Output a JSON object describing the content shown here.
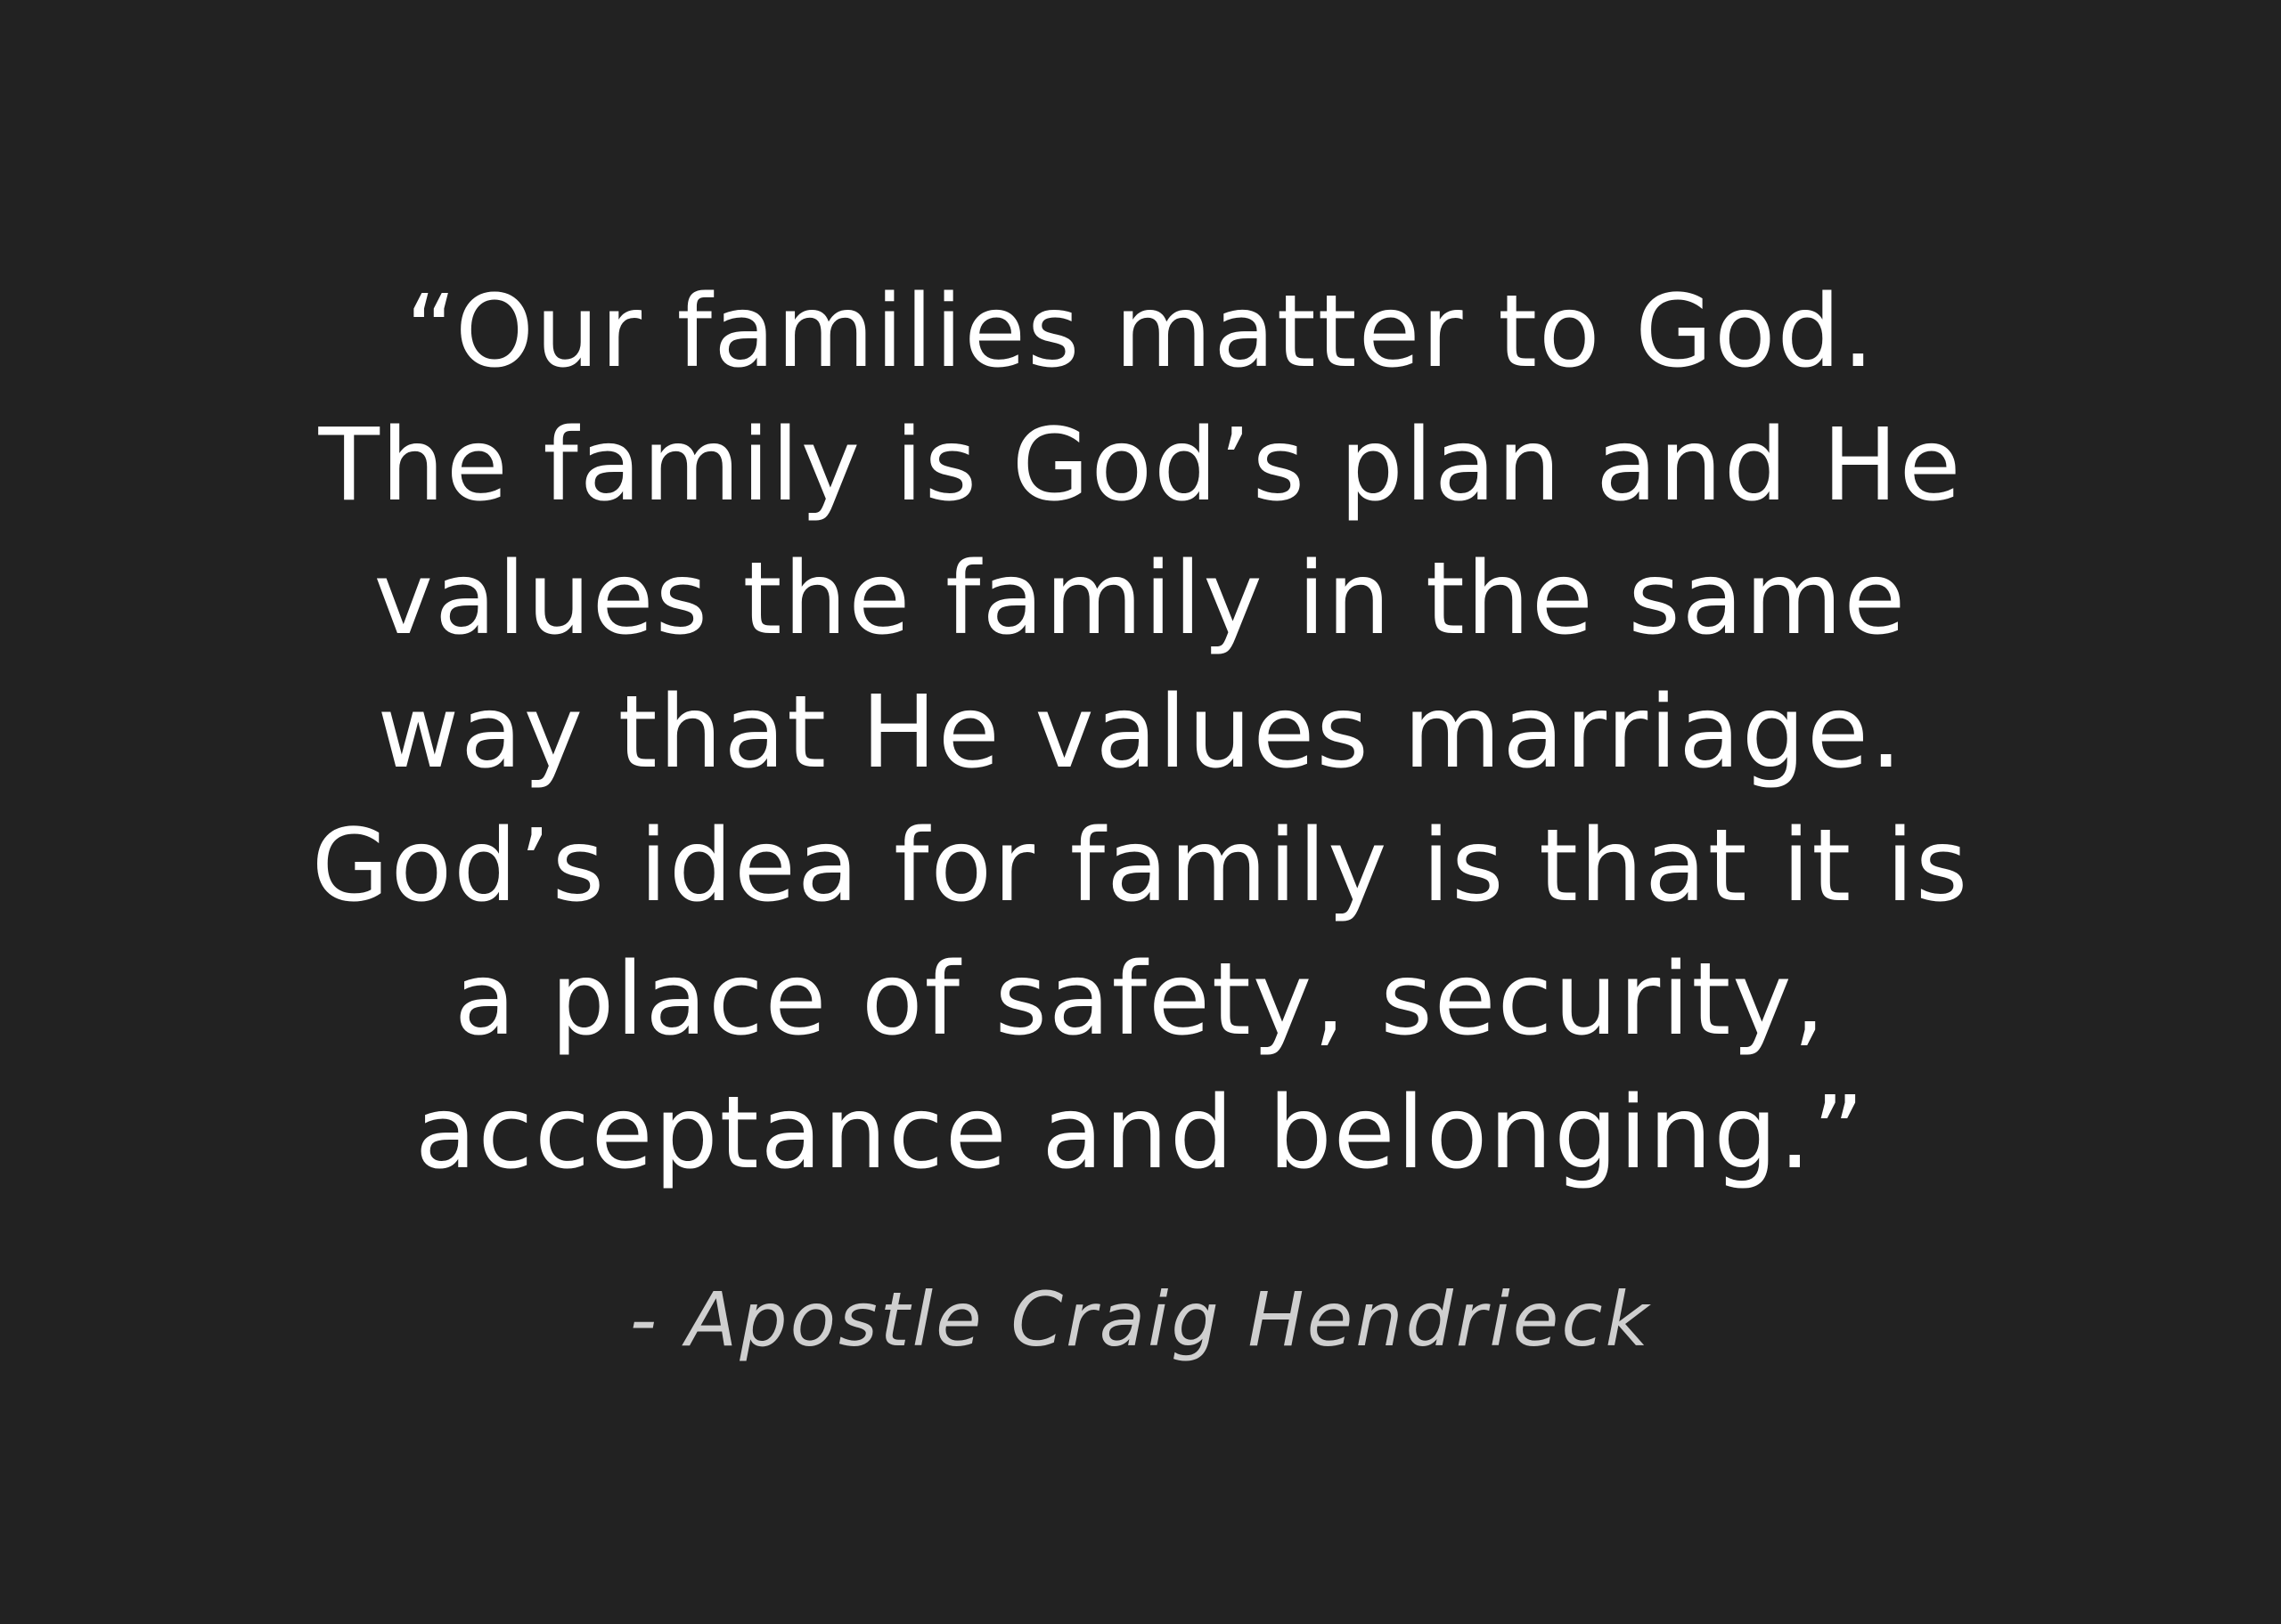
{
  "background_color": "#222222",
  "quote": {
    "text_color": "#ffffff",
    "lines": [
      "“Our families matter to God.",
      "The family is God’s plan and He",
      "values the family in the same",
      "way that He values marriage.",
      "God’s idea for family is that it is",
      "a place of safety, security,",
      "acceptance and belonging.”"
    ]
  },
  "attribution": {
    "text": "- Apostle Craig Hendrieck",
    "text_color": "#cfcfcf"
  }
}
